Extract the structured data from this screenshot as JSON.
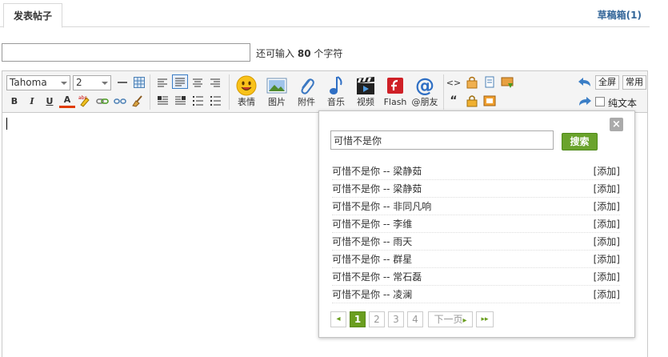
{
  "tabs": {
    "active_label": "发表帖子",
    "drafts_label": "草稿箱(1)"
  },
  "title_field": {
    "value": "",
    "hint_prefix": "还可输入",
    "hint_count": "80",
    "hint_suffix": "个字符"
  },
  "toolbar": {
    "font_family": "Tahoma",
    "font_size": "2",
    "bold": "B",
    "italic": "I",
    "underline": "U",
    "font_color": "A",
    "big_buttons": [
      {
        "label": "表情",
        "icon": "smiley-icon"
      },
      {
        "label": "图片",
        "icon": "image-icon"
      },
      {
        "label": "附件",
        "icon": "paperclip-icon"
      },
      {
        "label": "音乐",
        "icon": "music-note-icon"
      },
      {
        "label": "视频",
        "icon": "video-icon"
      },
      {
        "label": "Flash",
        "icon": "flash-icon"
      },
      {
        "label": "@朋友",
        "icon": "at-icon"
      }
    ],
    "fullscreen_label": "全屏",
    "common_label": "常用",
    "plain_text_label": "纯文本",
    "code_glyph": "<>",
    "quote_glyph": "“"
  },
  "popup": {
    "close_glyph": "×",
    "search_value": "可惜不是你",
    "search_button": "搜索",
    "add_label": "[添加]",
    "results": [
      {
        "title": "可惜不是你 -- 梁静茹"
      },
      {
        "title": "可惜不是你 -- 梁静茹"
      },
      {
        "title": "可惜不是你 -- 非同凡响"
      },
      {
        "title": "可惜不是你 -- 李维"
      },
      {
        "title": "可惜不是你 -- 雨天"
      },
      {
        "title": "可惜不是你 -- 群星"
      },
      {
        "title": "可惜不是你 -- 常石磊"
      },
      {
        "title": "可惜不是你 -- 凌澜"
      }
    ],
    "pager": {
      "prev_glyph": "◂",
      "pages": [
        "1",
        "2",
        "3",
        "4"
      ],
      "current": "1",
      "next_label": "下一页",
      "last_glyph": "▸▸"
    }
  },
  "colors": {
    "link": "#336699",
    "search_button": "#6aa32c",
    "pager_current": "#6a9e1f"
  }
}
